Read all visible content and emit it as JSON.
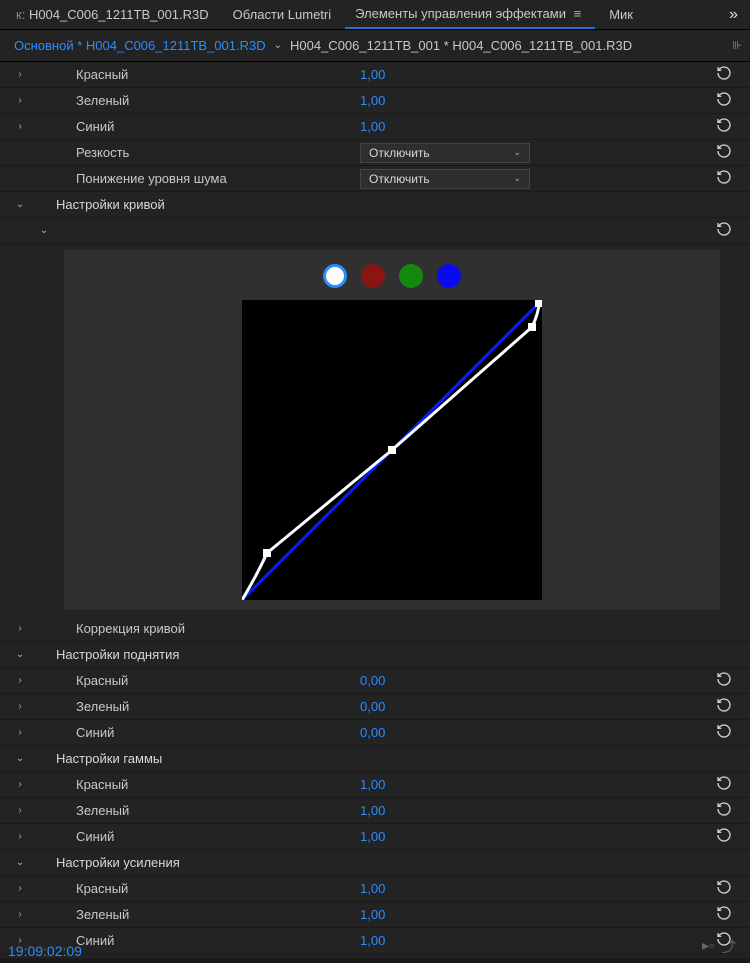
{
  "tabs": {
    "prefix": "к:",
    "source": "H004_C006_1211TB_001.R3D",
    "lumetri": "Области Lumetri",
    "effects": "Элементы управления эффектами",
    "mix": "Мик"
  },
  "subheader": {
    "primary": "Основной * H004_C006_1211TB_001.R3D",
    "secondary": "H004_C006_1211TB_001 * H004_C006_1211TB_001.R3D"
  },
  "rows": {
    "red": "Красный",
    "green": "Зеленый",
    "blue": "Синий",
    "sharpness": "Резкость",
    "denoise": "Понижение уровня шума",
    "disable": "Отключить"
  },
  "values": {
    "one": "1,00",
    "zero": "0,00"
  },
  "sections": {
    "curve": "Настройки кривой",
    "curveCorrection": "Коррекция кривой",
    "lift": "Настройки поднятия",
    "gamma": "Настройки гаммы",
    "gain": "Настройки усиления"
  },
  "timecode": "19:09:02:09"
}
